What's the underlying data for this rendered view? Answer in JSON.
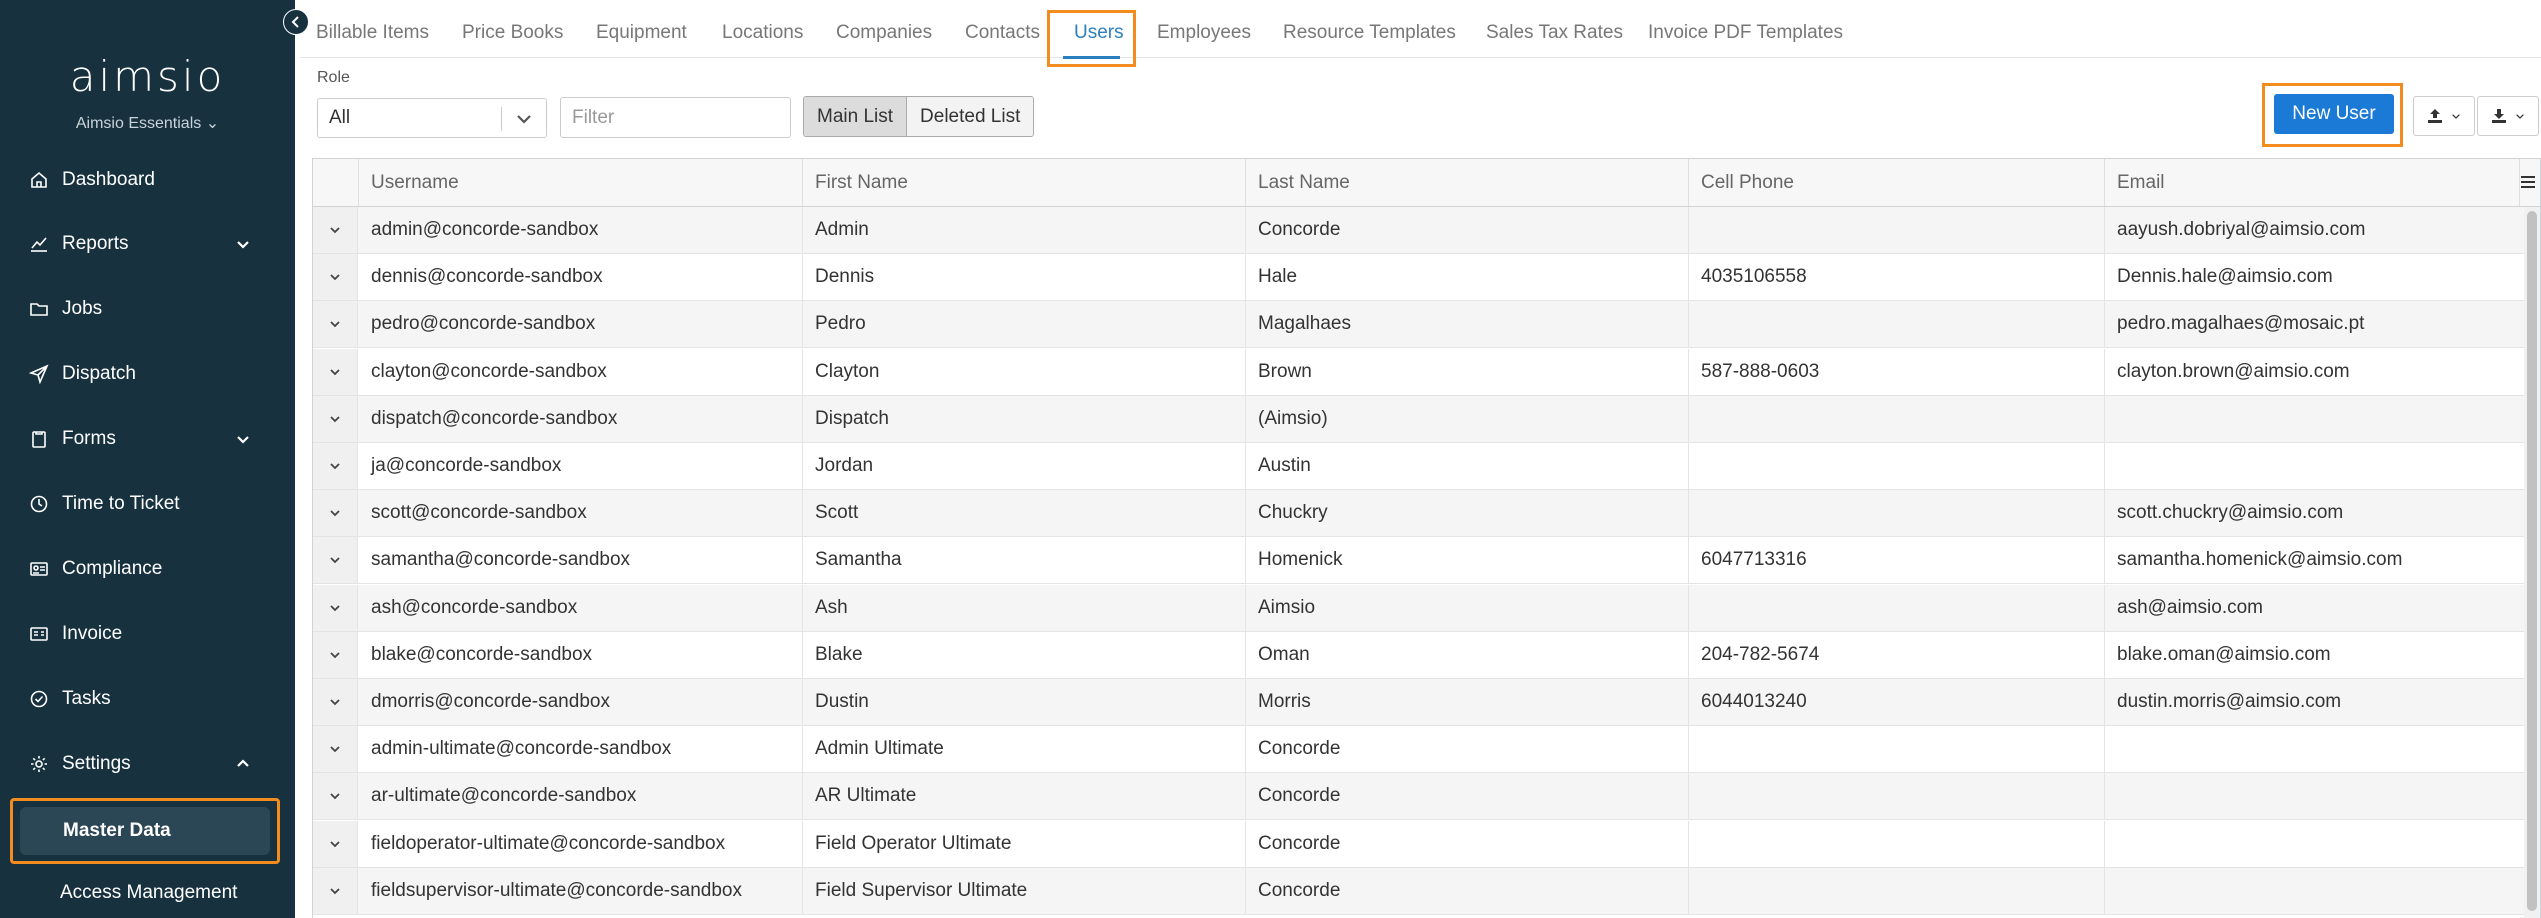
{
  "sidebar": {
    "logo": "aimsio",
    "workspace": "Aimsio Essentials",
    "items": [
      {
        "label": "Dashboard",
        "icon": "home-icon"
      },
      {
        "label": "Reports",
        "icon": "chart-icon"
      },
      {
        "label": "Jobs",
        "icon": "folder-icon"
      },
      {
        "label": "Dispatch",
        "icon": "send-icon"
      },
      {
        "label": "Forms",
        "icon": "clipboard-icon"
      },
      {
        "label": "Time to Ticket",
        "icon": "clock-icon"
      },
      {
        "label": "Compliance",
        "icon": "id-card-icon"
      },
      {
        "label": "Invoice",
        "icon": "invoice-icon"
      },
      {
        "label": "Tasks",
        "icon": "check-circle-icon"
      },
      {
        "label": "Settings",
        "icon": "gear-icon"
      }
    ],
    "active_subitem": "Master Data",
    "subitem_2": "Access Management"
  },
  "tabs": [
    "Billable Items",
    "Price Books",
    "Equipment",
    "Locations",
    "Companies",
    "Contacts",
    "Users",
    "Employees",
    "Resource Templates",
    "Sales Tax Rates",
    "Invoice PDF Templates"
  ],
  "active_tab": "Users",
  "toolbar": {
    "role_label": "Role",
    "role_value": "All",
    "filter_placeholder": "Filter",
    "main_list": "Main List",
    "deleted_list": "Deleted List",
    "new_user": "New User"
  },
  "grid": {
    "columns": [
      "Username",
      "First Name",
      "Last Name",
      "Cell Phone",
      "Email"
    ],
    "rows": [
      [
        "admin@concorde-sandbox",
        "Admin",
        "Concorde",
        "",
        "aayush.dobriyal@aimsio.com"
      ],
      [
        "dennis@concorde-sandbox",
        "Dennis",
        "Hale",
        "4035106558",
        "Dennis.hale@aimsio.com"
      ],
      [
        "pedro@concorde-sandbox",
        "Pedro",
        "Magalhaes",
        "",
        "pedro.magalhaes@mosaic.pt"
      ],
      [
        "clayton@concorde-sandbox",
        "Clayton",
        "Brown",
        "587-888-0603",
        "clayton.brown@aimsio.com"
      ],
      [
        "dispatch@concorde-sandbox",
        "Dispatch",
        "(Aimsio)",
        "",
        ""
      ],
      [
        "ja@concorde-sandbox",
        "Jordan",
        "Austin",
        "",
        ""
      ],
      [
        "scott@concorde-sandbox",
        "Scott",
        "Chuckry",
        "",
        "scott.chuckry@aimsio.com"
      ],
      [
        "samantha@concorde-sandbox",
        "Samantha",
        "Homenick",
        "6047713316",
        "samantha.homenick@aimsio.com"
      ],
      [
        "ash@concorde-sandbox",
        "Ash",
        "Aimsio",
        "",
        "ash@aimsio.com"
      ],
      [
        "blake@concorde-sandbox",
        "Blake",
        "Oman",
        "204-782-5674",
        "blake.oman@aimsio.com"
      ],
      [
        "dmorris@concorde-sandbox",
        "Dustin",
        "Morris",
        "6044013240",
        "dustin.morris@aimsio.com"
      ],
      [
        "admin-ultimate@concorde-sandbox",
        "Admin Ultimate",
        "Concorde",
        "",
        ""
      ],
      [
        "ar-ultimate@concorde-sandbox",
        "AR Ultimate",
        "Concorde",
        "",
        ""
      ],
      [
        "fieldoperator-ultimate@concorde-sandbox",
        "Field Operator Ultimate",
        "Concorde",
        "",
        ""
      ],
      [
        "fieldsupervisor-ultimate@concorde-sandbox",
        "Field Supervisor Ultimate",
        "Concorde",
        "",
        ""
      ]
    ]
  },
  "colors": {
    "sidebar_bg": "#17313f",
    "accent": "#1a7ad6",
    "highlight": "#f28c1e",
    "tab_active": "#2a7fbf"
  }
}
